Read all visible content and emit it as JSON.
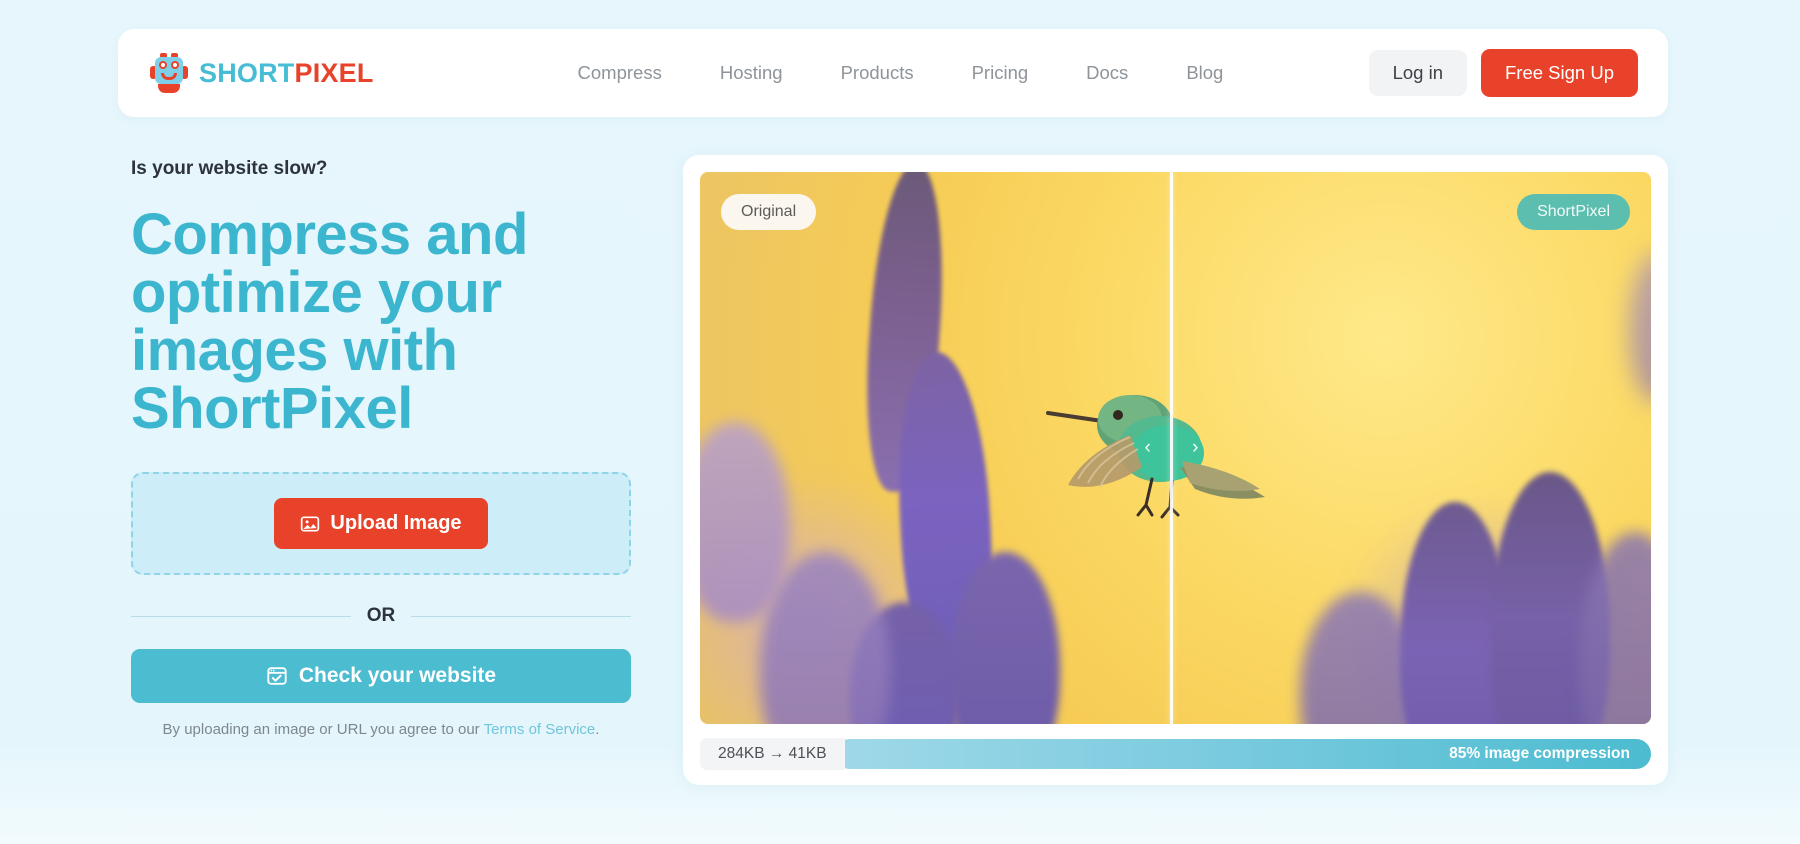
{
  "brand": {
    "logo_icon": "robot-mascot-icon",
    "name_part1": "SHORT",
    "name_part2": "PIXEL",
    "color_teal": "#46bdd4",
    "color_red": "#e8432a"
  },
  "nav": {
    "items": [
      {
        "label": "Compress"
      },
      {
        "label": "Hosting"
      },
      {
        "label": "Products"
      },
      {
        "label": "Pricing"
      },
      {
        "label": "Docs"
      },
      {
        "label": "Blog"
      }
    ],
    "login_label": "Log in",
    "signup_label": "Free Sign Up"
  },
  "hero": {
    "eyebrow": "Is your website slow?",
    "headline": "Compress and optimize your images with ShortPixel",
    "upload_button_label": "Upload Image",
    "upload_icon": "image-icon",
    "or_label": "OR",
    "website_button_label": "Check your website",
    "website_icon": "browser-check-icon",
    "terms_prefix": "By uploading an image or URL you agree to our ",
    "terms_link": "Terms of Service",
    "terms_suffix": "."
  },
  "comparison": {
    "left_label": "Original",
    "right_label": "ShortPixel",
    "slider_left_icon": "chevron-left-icon",
    "slider_right_icon": "chevron-right-icon",
    "photo_subject": "hummingbird-feeding-on-purple-salvia-flowers",
    "size_before": "284KB",
    "size_arrow": "→",
    "size_after": "41KB",
    "size_summary": "284KB → 41KB",
    "compression_label": "85% image compression",
    "compression_percent": 85,
    "bar_color": "#4cbcd0"
  }
}
